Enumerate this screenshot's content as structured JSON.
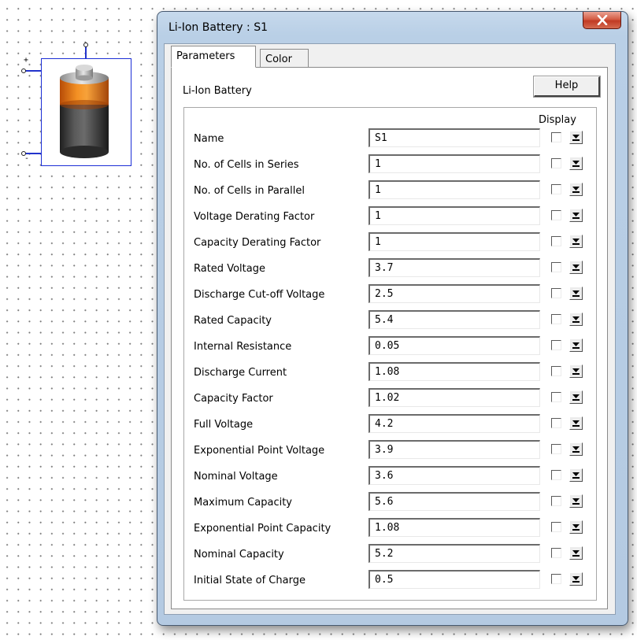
{
  "schematic": {
    "component_icon": "li-ion-battery-icon",
    "positive_terminal": "+",
    "negative_terminal": "-"
  },
  "dialog": {
    "title": "Li-Ion Battery : S1",
    "close_icon": "close-x-icon",
    "tabs": [
      {
        "label": "Parameters",
        "active": true
      },
      {
        "label": "Color",
        "active": false
      }
    ],
    "section_label": "Li-Ion Battery",
    "help_label": "Help",
    "display_header": "Display",
    "params": [
      {
        "label": "Name",
        "value": "S1",
        "display": false
      },
      {
        "label": "No. of Cells in Series",
        "value": "1",
        "display": false
      },
      {
        "label": "No. of Cells in Parallel",
        "value": "1",
        "display": false
      },
      {
        "label": "Voltage Derating Factor",
        "value": "1",
        "display": false
      },
      {
        "label": "Capacity Derating Factor",
        "value": "1",
        "display": false
      },
      {
        "label": "Rated Voltage",
        "value": "3.7",
        "display": false
      },
      {
        "label": "Discharge Cut-off Voltage",
        "value": "2.5",
        "display": false
      },
      {
        "label": "Rated Capacity",
        "value": "5.4",
        "display": false
      },
      {
        "label": "Internal Resistance",
        "value": "0.05",
        "display": false
      },
      {
        "label": "Discharge Current",
        "value": "1.08",
        "display": false
      },
      {
        "label": "Capacity Factor",
        "value": "1.02",
        "display": false
      },
      {
        "label": "Full Voltage",
        "value": "4.2",
        "display": false
      },
      {
        "label": "Exponential Point Voltage",
        "value": "3.9",
        "display": false
      },
      {
        "label": "Nominal Voltage",
        "value": "3.6",
        "display": false
      },
      {
        "label": "Maximum Capacity",
        "value": "5.6",
        "display": false
      },
      {
        "label": "Exponential Point Capacity",
        "value": "1.08",
        "display": false
      },
      {
        "label": "Nominal Capacity",
        "value": "5.2",
        "display": false
      },
      {
        "label": "Initial State of Charge",
        "value": "0.5",
        "display": false
      }
    ]
  }
}
